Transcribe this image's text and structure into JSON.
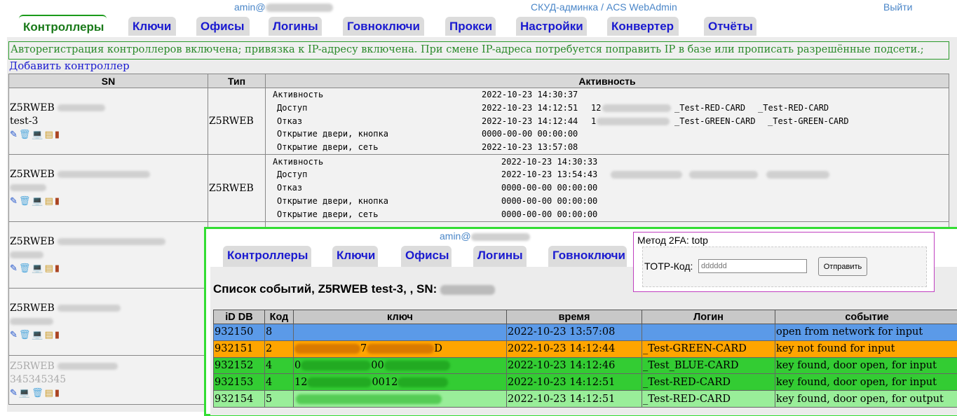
{
  "header": {
    "user": "amin@",
    "title": "СКУД-админка / ACS WebAdmin",
    "logout": "Выйти"
  },
  "tabs": [
    "Контроллеры",
    "Ключи",
    "Офисы",
    "Логины",
    "Говноключи",
    "Прокси",
    "Настройки",
    "Конвертер",
    "Отчёты"
  ],
  "notice": "Авторегистрация контроллеров включена; привязка к IP-адресу включена. При смене IP-адреса потребуется поправить IP в базе или прописать разрешённые подсети.;",
  "add_controller": "Добавить контроллер",
  "table": {
    "headers": [
      "SN",
      "Тип",
      "Активность"
    ],
    "rows": [
      {
        "sn": "Z5RWEB",
        "name": "test-3",
        "type": "Z5RWEB",
        "activity": [
          {
            "label": "Активность",
            "time": "2022-10-23 14:30:37",
            "key": "",
            "c1": "",
            "c2": ""
          },
          {
            "label": "Доступ",
            "time": "2022-10-23 14:12:51",
            "key": "12",
            "c1": "_Test-RED-CARD",
            "c2": "_Test-RED-CARD"
          },
          {
            "label": "Отказ",
            "time": "2022-10-23 14:12:44",
            "key": "1",
            "c1": "_Test-GREEN-CARD",
            "c2": "_Test-GREEN-CARD"
          },
          {
            "label": "Открытие двери, кнопка",
            "time": "0000-00-00 00:00:00",
            "key": "",
            "c1": "",
            "c2": ""
          },
          {
            "label": "Открытие двери, сеть",
            "time": "2022-10-23 13:57:08",
            "key": "",
            "c1": "",
            "c2": ""
          }
        ]
      },
      {
        "sn": "Z5RWEB",
        "name": "",
        "type": "Z5RWEB",
        "activity": [
          {
            "label": "Активность",
            "time": "2022-10-23 14:30:33"
          },
          {
            "label": "Доступ",
            "time": "2022-10-23 13:54:43"
          },
          {
            "label": "Отказ",
            "time": "0000-00-00 00:00:00"
          },
          {
            "label": "Открытие двери, кнопка",
            "time": "0000-00-00 00:00:00"
          },
          {
            "label": "Открытие двери, сеть",
            "time": "0000-00-00 00:00:00"
          }
        ]
      },
      {
        "sn": "Z5RWEB",
        "name": "",
        "type": ""
      },
      {
        "sn": "Z5RWEB",
        "name": "",
        "type": ""
      },
      {
        "sn": "Z5RWEB",
        "name": "345345345",
        "type": ""
      }
    ]
  },
  "overlay": {
    "user": "amin@",
    "tabs": [
      "Контроллеры",
      "Ключи",
      "Офисы",
      "Логины",
      "Говноключи"
    ],
    "twofa": {
      "method": "Метод 2FA: totp",
      "label": "TOTP-Код:",
      "placeholder": "dddddd",
      "submit": "Отправить"
    },
    "title": "Список событий, Z5RWEB test-3, , SN:",
    "headers": [
      "iD DB",
      "Код",
      "ключ",
      "время",
      "Логин",
      "событие"
    ],
    "rows": [
      {
        "id": "932150",
        "code": "8",
        "key_a": "",
        "key_b": "",
        "key_c": "",
        "time": "2022-10-23 13:57:08",
        "login": "",
        "event": "open from network for input",
        "color": "#5b9ae8"
      },
      {
        "id": "932151",
        "code": "2",
        "key_a": "",
        "key_b": "7",
        "key_c": "D",
        "time": "2022-10-23 14:12:44",
        "login": "_Test-GREEN-CARD",
        "event": "key not found for input",
        "color": "#ffa500"
      },
      {
        "id": "932152",
        "code": "4",
        "key_a": "0",
        "key_b": "00",
        "key_c": "",
        "time": "2022-10-23 14:12:46",
        "login": "_Test_BLUE-CARD",
        "event": "key found, door open, for input",
        "color": "#33cc33"
      },
      {
        "id": "932153",
        "code": "4",
        "key_a": "12",
        "key_b": "0012",
        "key_c": "",
        "time": "2022-10-23 14:12:51",
        "login": "_Test-RED-CARD",
        "event": "key found, door open, for input",
        "color": "#33cc33"
      },
      {
        "id": "932154",
        "code": "5",
        "key_a": "",
        "key_b": "",
        "key_c": "",
        "time": "2022-10-23 14:12:51",
        "login": "_Test-RED-CARD",
        "event": "key found, door open, for output",
        "color": "#99ee99"
      }
    ]
  }
}
